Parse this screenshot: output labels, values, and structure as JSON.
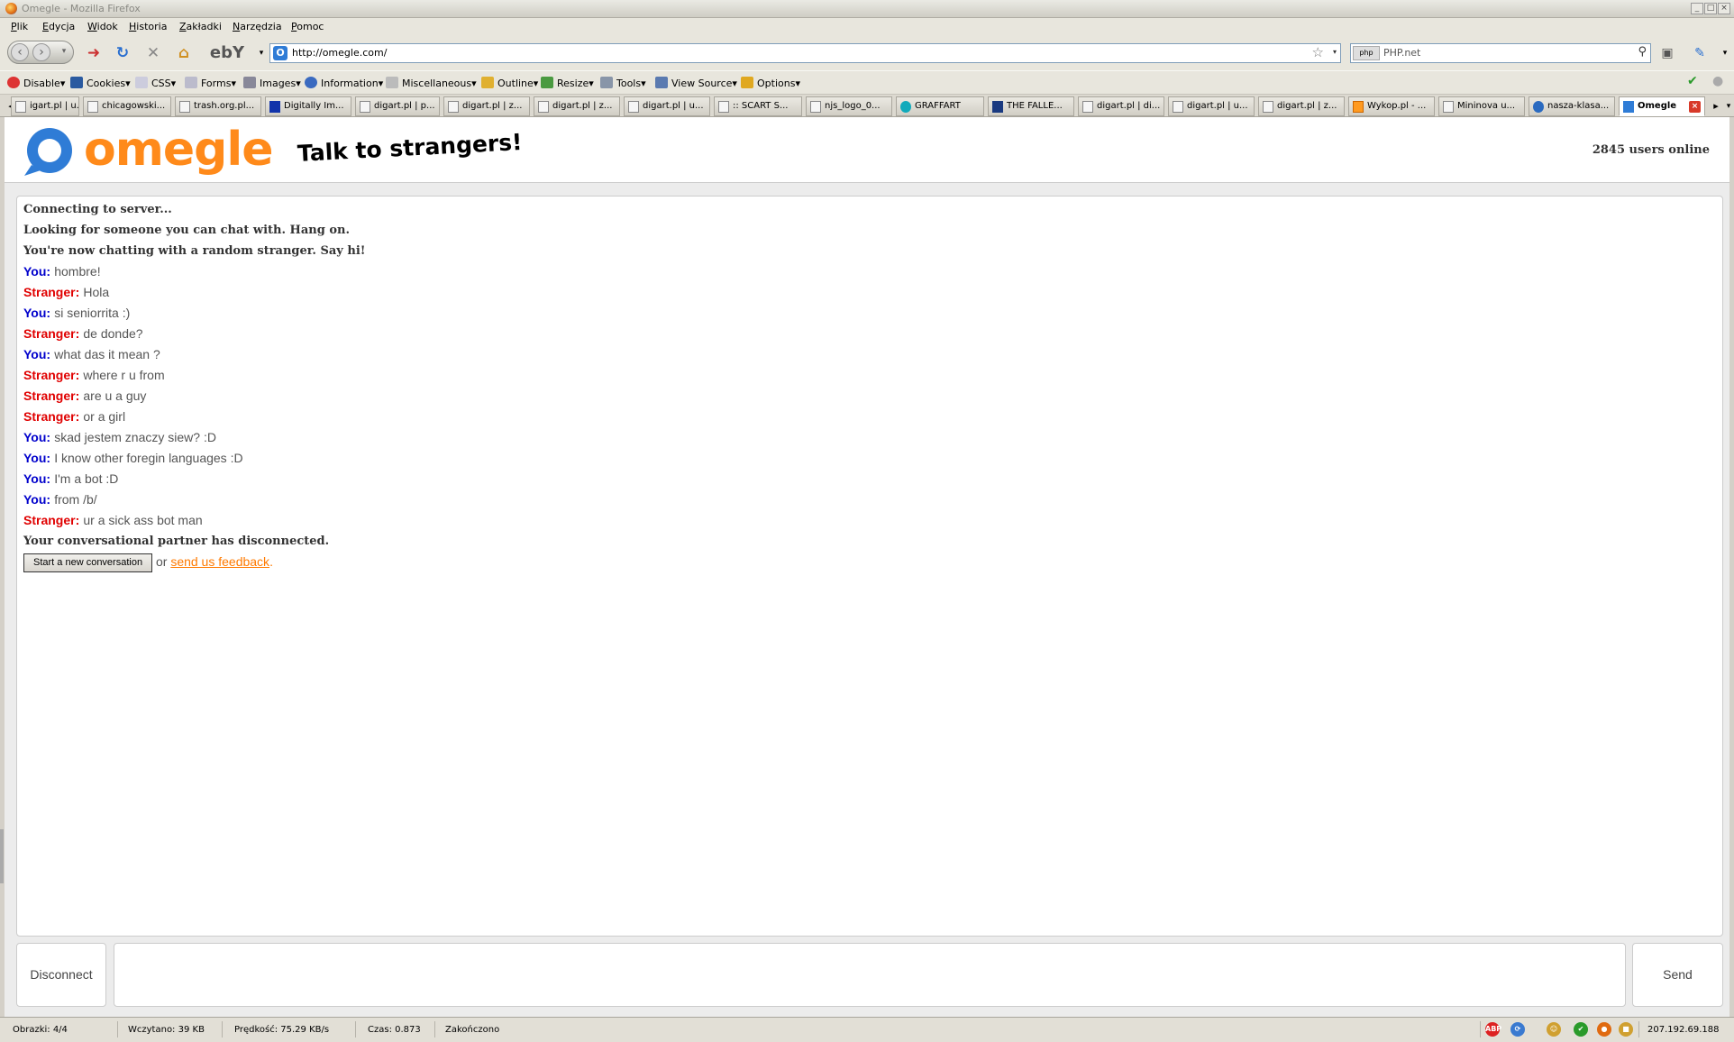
{
  "window": {
    "title": "Omegle - Mozilla Firefox"
  },
  "menu": [
    "Plik",
    "Edycja",
    "Widok",
    "Historia",
    "Zakładki",
    "Narzędzia",
    "Pomoc"
  ],
  "navbar": {
    "url": "http://omegle.com/",
    "search_engine": "php",
    "search_placeholder": "PHP.net",
    "ebay_logo": "ebY"
  },
  "webdev_toolbar": [
    "Disable",
    "Cookies",
    "CSS",
    "Forms",
    "Images",
    "Information",
    "Miscellaneous",
    "Outline",
    "Resize",
    "Tools",
    "View Source",
    "Options"
  ],
  "tabs": [
    {
      "label": "igart.pl | u...",
      "active": false
    },
    {
      "label": "chicagowski...",
      "active": false
    },
    {
      "label": "trash.org.pl...",
      "active": false
    },
    {
      "label": "Digitally Im...",
      "active": false
    },
    {
      "label": "digart.pl | p...",
      "active": false
    },
    {
      "label": "digart.pl | z...",
      "active": false
    },
    {
      "label": "digart.pl | z...",
      "active": false
    },
    {
      "label": "digart.pl | u...",
      "active": false
    },
    {
      "label": ":: SCART S...",
      "active": false
    },
    {
      "label": "njs_logo_0...",
      "active": false
    },
    {
      "label": "GRAFFART",
      "active": false
    },
    {
      "label": "THE FALLE...",
      "active": false
    },
    {
      "label": "digart.pl | di...",
      "active": false
    },
    {
      "label": "digart.pl | u...",
      "active": false
    },
    {
      "label": "digart.pl | z...",
      "active": false
    },
    {
      "label": "Wykop.pl - ...",
      "active": false
    },
    {
      "label": "Mininova u...",
      "active": false
    },
    {
      "label": "nasza-klasa...",
      "active": false
    },
    {
      "label": "Omegle",
      "active": true
    }
  ],
  "page": {
    "logo_text": "omegle",
    "tagline": "Talk to strangers!",
    "users_online": "2845 users online",
    "system_start": [
      "Connecting to server...",
      "Looking for someone you can chat with. Hang on.",
      "You're now chatting with a random stranger. Say hi!"
    ],
    "messages": [
      {
        "who": "You:",
        "type": "you",
        "text": "hombre!"
      },
      {
        "who": "Stranger:",
        "type": "stranger",
        "text": "Hola"
      },
      {
        "who": "You:",
        "type": "you",
        "text": "si seniorrita :)"
      },
      {
        "who": "Stranger:",
        "type": "stranger",
        "text": "de donde?"
      },
      {
        "who": "You:",
        "type": "you",
        "text": "what das it mean ?"
      },
      {
        "who": "Stranger:",
        "type": "stranger",
        "text": "where r u from"
      },
      {
        "who": "Stranger:",
        "type": "stranger",
        "text": "are u a guy"
      },
      {
        "who": "Stranger:",
        "type": "stranger",
        "text": "or a girl"
      },
      {
        "who": "You:",
        "type": "you",
        "text": "skad jestem znaczy siew? :D"
      },
      {
        "who": "You:",
        "type": "you",
        "text": "I know other foregin languages :D"
      },
      {
        "who": "You:",
        "type": "you",
        "text": "I'm a bot :D"
      },
      {
        "who": "You:",
        "type": "you",
        "text": "from /b/"
      },
      {
        "who": "Stranger:",
        "type": "stranger",
        "text": "ur a sick ass bot man"
      }
    ],
    "system_end": "Your conversational partner has disconnected.",
    "new_conversation_label": "Start a new conversation",
    "or_text": "or",
    "feedback_link": "send us feedback",
    "feedback_period": ".",
    "disconnect_label": "Disconnect",
    "send_label": "Send",
    "chat_input_value": ""
  },
  "statusbar": {
    "images": "Obrazki: 4/4",
    "loaded": "Wczytano: 39 KB",
    "speed": "Prędkość: 75.29 KB/s",
    "time": "Czas: 0.873",
    "state": "Zakończono",
    "ip": "207.192.69.188",
    "abp": "ABP"
  },
  "colors": {
    "you": "#0000cc",
    "stranger": "#e00000",
    "logo_orange": "#ff8a1a",
    "logo_blue": "#2f7cd6"
  }
}
